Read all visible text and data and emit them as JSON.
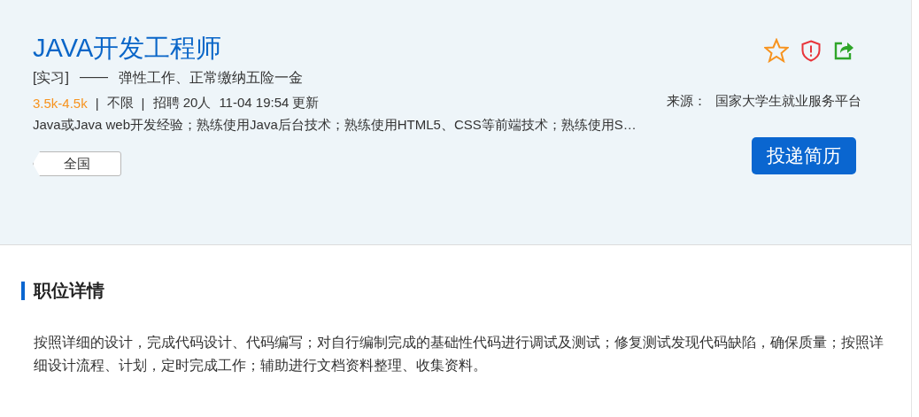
{
  "job": {
    "title": "JAVA开发工程师",
    "type": "[实习]",
    "dash": "——",
    "benefits": "弹性工作、正常缴纳五险一金",
    "salary": "3.5k-4.5k",
    "separator": "|",
    "education": "不限",
    "hiring": "招聘 20人",
    "updated": "11-04 19:54 更新",
    "description": "Java或Java web开发经验；熟练使用Java后台技术；熟练使用HTML5、CSS等前端技术；熟练使用S…",
    "location": "全国",
    "source_label": "来源：",
    "source": "国家大学生就业服务平台",
    "apply_button": "投递简历",
    "actions": [
      {
        "kind": "favorite"
      },
      {
        "kind": "report"
      },
      {
        "kind": "share"
      }
    ]
  },
  "details": {
    "heading": "职位详情",
    "text": "按照详细的设计，完成代码设计、代码编写；对自行编制完成的基础性代码进行调试及测试；修复测试发现代码缺陷，确保质量；按照详细设计流程、计划，定时完成工作；辅助进行文档资料整理、收集资料。"
  }
}
